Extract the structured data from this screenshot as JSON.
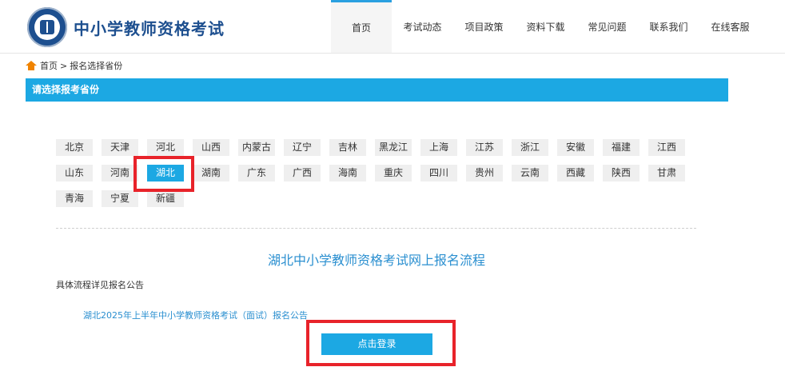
{
  "site": {
    "title": "中小学教师资格考试"
  },
  "nav": {
    "items": [
      {
        "label": "首页",
        "active": true
      },
      {
        "label": "考试动态"
      },
      {
        "label": "项目政策"
      },
      {
        "label": "资料下载"
      },
      {
        "label": "常见问题"
      },
      {
        "label": "联系我们"
      },
      {
        "label": "在线客服"
      }
    ]
  },
  "breadcrumb": {
    "home": "首页",
    "separator": ">",
    "current": "报名选择省份"
  },
  "section": {
    "title": "请选择报考省份"
  },
  "provinces": {
    "selected": "湖北",
    "rows": [
      [
        "北京",
        "天津",
        "河北",
        "山西",
        "内蒙古",
        "辽宁",
        "吉林",
        "黑龙江",
        "上海",
        "江苏",
        "浙江",
        "安徽",
        "福建",
        "江西"
      ],
      [
        "山东",
        "河南",
        "湖北",
        "湖南",
        "广东",
        "广西",
        "海南",
        "重庆",
        "四川",
        "贵州",
        "云南",
        "西藏",
        "陕西",
        "甘肃"
      ],
      [
        "青海",
        "宁夏",
        "新疆"
      ]
    ]
  },
  "flow": {
    "title": "湖北中小学教师资格考试网上报名流程",
    "subtitle": "具体流程详见报名公告",
    "notice_link": "湖北2025年上半年中小学教师资格考试（面试）报名公告",
    "login_button": "点击登录"
  },
  "colors": {
    "accent": "#1ca8e3",
    "brand": "#1d4f8f",
    "highlight": "#e8232a",
    "home_icon": "#f08300"
  }
}
